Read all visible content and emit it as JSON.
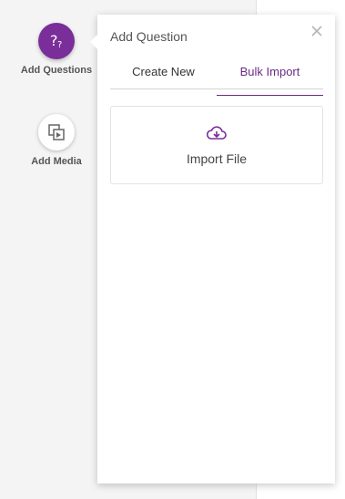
{
  "sidebar": {
    "items": [
      {
        "label": "Add Questions",
        "icon": "question-mark-icon"
      },
      {
        "label": "Add Media",
        "icon": "media-icon"
      }
    ]
  },
  "panel": {
    "title": "Add Question",
    "close_icon": "close-icon",
    "tabs": [
      {
        "label": "Create New",
        "active": false
      },
      {
        "label": "Bulk Import",
        "active": true
      }
    ],
    "import": {
      "label": "Import File",
      "icon": "cloud-upload-icon"
    }
  },
  "colors": {
    "accent": "#7a2e9a",
    "tab_active": "#6b2a86"
  }
}
